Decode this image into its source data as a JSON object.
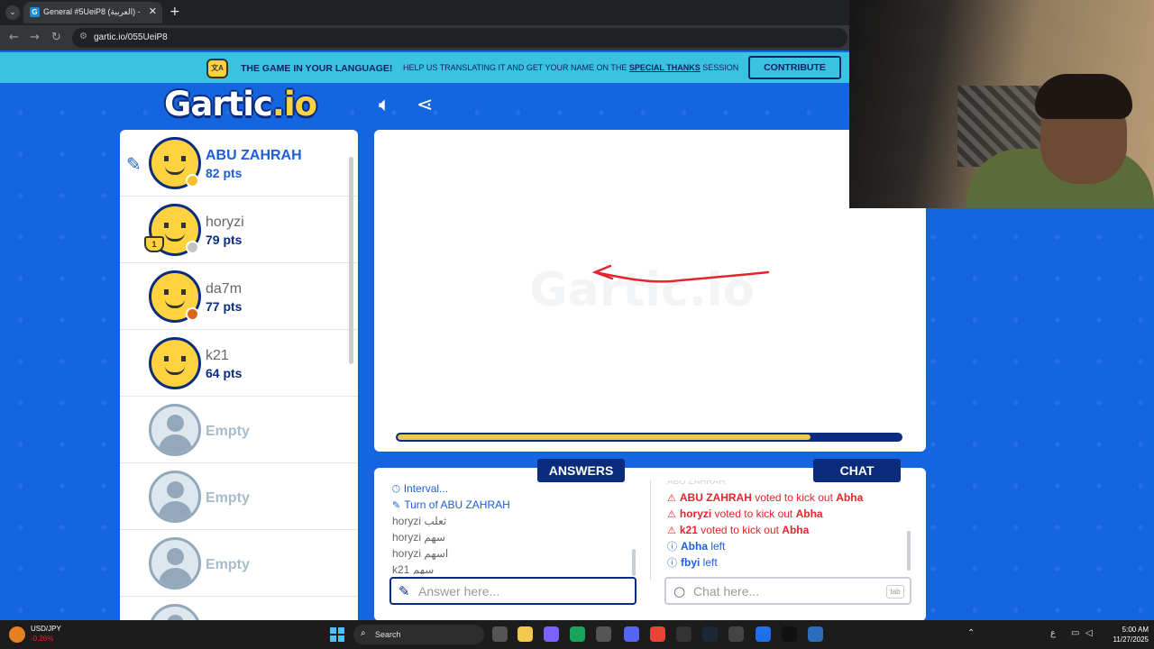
{
  "browser": {
    "tab_title": "General #5UeiP8 (العربية) - Gartic.io",
    "url": "gartic.io/055UeiP8"
  },
  "banner": {
    "headline": "THE GAME IN YOUR LANGUAGE!",
    "text_prefix": "HELP US TRANSLATING IT AND GET YOUR NAME ON THE",
    "special_thanks": "SPECIAL THANKS",
    "text_suffix": "SESSION",
    "contribute_label": "CONTRIBUTE",
    "icon_text": "文A"
  },
  "logo": {
    "main": "Gartic",
    "suffix": ".io"
  },
  "players": [
    {
      "name": "ABU ZAHRAH",
      "points": "82 pts",
      "status_color": "#f2c230",
      "drawing": true
    },
    {
      "name": "horyzi",
      "points": "79 pts",
      "status_color": "#c4c4c4",
      "trophy": "1"
    },
    {
      "name": "da7m",
      "points": "77 pts",
      "status_color": "#d9661c"
    },
    {
      "name": "k21",
      "points": "64 pts",
      "status_color": null
    },
    {
      "name": "Empty"
    },
    {
      "name": "Empty"
    },
    {
      "name": "Empty"
    }
  ],
  "canvas": {
    "watermark": "Gartic.io",
    "timer_progress": 0.82,
    "stroke_color": "#e2262b"
  },
  "answers": {
    "tab_label": "ANSWERS",
    "feed": [
      {
        "icon": "clock-icon",
        "text": "Interval...",
        "style": "blue"
      },
      {
        "icon": "pencil-icon",
        "prefix": "Turn of ",
        "name": "ABU ZAHRAH",
        "style": "blue"
      },
      {
        "user": "horyzi",
        "guess": "ثعلب"
      },
      {
        "user": "horyzi",
        "guess": "سهم"
      },
      {
        "user": "horyzi",
        "guess": "اسهم"
      },
      {
        "user": "k21",
        "guess": "سهم"
      }
    ],
    "placeholder": "Answer here..."
  },
  "chat": {
    "tab_label": "CHAT",
    "faded_line": "ABU ZAHRAH",
    "feed": [
      {
        "type": "warning",
        "user": "ABU ZAHRAH",
        "action": " voted to kick out ",
        "target": "Abha"
      },
      {
        "type": "warning",
        "user": "horyzi",
        "action": " voted to kick out ",
        "target": "Abha"
      },
      {
        "type": "warning",
        "user": "k21",
        "action": " voted to kick out ",
        "target": "Abha"
      },
      {
        "type": "info",
        "user": "Abha",
        "action": " left"
      },
      {
        "type": "info",
        "user": "fbyi",
        "action": " left"
      }
    ],
    "placeholder": "Chat here...",
    "tab_hint": "tab"
  },
  "taskbar": {
    "ticker_symbol": "USD/JPY",
    "ticker_value": "-0,26%",
    "search_label": "Search",
    "time": "5:00 AM",
    "date": "11/27/2025",
    "lang": "ع"
  }
}
